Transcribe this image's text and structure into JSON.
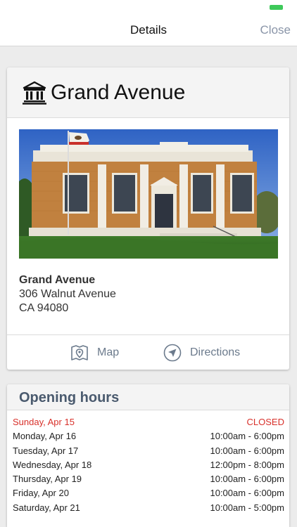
{
  "navbar": {
    "title": "Details",
    "close_label": "Close"
  },
  "library": {
    "name": "Grand Avenue",
    "icon": "library-building-icon",
    "address": {
      "name": "Grand Avenue",
      "street": "306 Walnut Avenue",
      "city_line": "CA 94080"
    },
    "photo": "library-building-photo"
  },
  "actions": {
    "map_label": "Map",
    "directions_label": "Directions"
  },
  "hours": {
    "title": "Opening hours",
    "rows": [
      {
        "day": "Sunday, Apr 15",
        "time": "CLOSED",
        "today": true
      },
      {
        "day": "Monday, Apr 16",
        "time": "10:00am - 6:00pm"
      },
      {
        "day": "Tuesday, Apr 17",
        "time": "10:00am - 6:00pm"
      },
      {
        "day": "Wednesday, Apr 18",
        "time": "12:00pm - 8:00pm"
      },
      {
        "day": "Thursday, Apr 19",
        "time": "10:00am - 6:00pm"
      },
      {
        "day": "Friday, Apr 20",
        "time": "10:00am - 6:00pm"
      },
      {
        "day": "Saturday, Apr 21",
        "time": "10:00am - 5:00pm"
      }
    ]
  },
  "colors": {
    "accent": "#8a95a8",
    "closed": "#d8302a",
    "battery": "#3ec95a"
  }
}
